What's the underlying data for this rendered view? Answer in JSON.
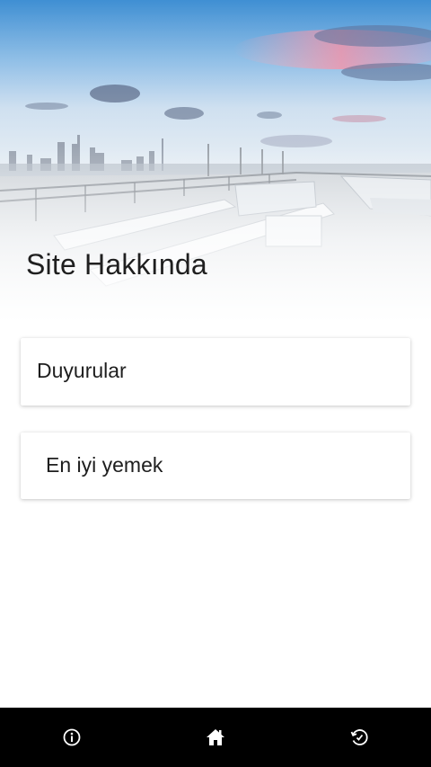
{
  "header": {
    "title": "Site Hakkında"
  },
  "menu": {
    "items": [
      {
        "label": "Duyurular"
      },
      {
        "label": "En iyi yemek"
      }
    ]
  },
  "bottom_nav": {
    "items": [
      {
        "icon": "info-icon"
      },
      {
        "icon": "home-icon"
      },
      {
        "icon": "history-icon"
      }
    ]
  },
  "colors": {
    "nav_background": "#000000",
    "nav_icon": "#ffffff",
    "title_text": "#1f1f1f",
    "card_background": "#ffffff"
  }
}
